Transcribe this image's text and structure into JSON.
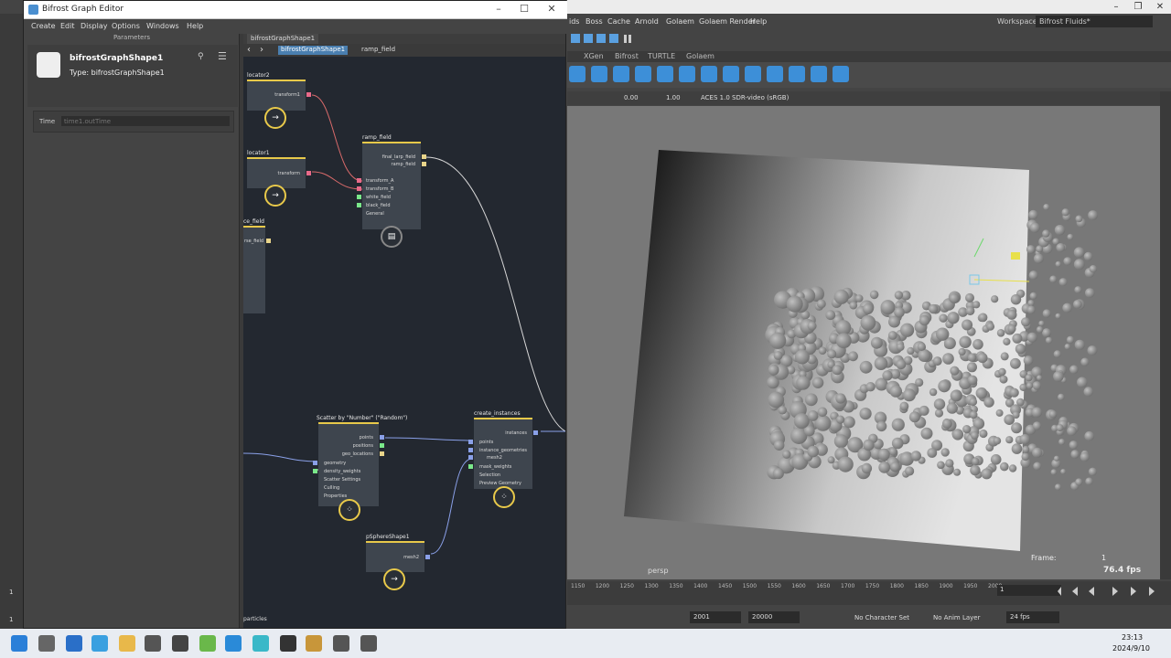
{
  "bifrost_editor": {
    "title": "Bifrost Graph Editor",
    "menu": [
      "Create",
      "Edit",
      "Display",
      "Options",
      "Windows",
      "Help"
    ],
    "parameters": {
      "header": "Parameters",
      "node_name": "bifrostGraphShape1",
      "node_type": "Type: bifrostGraphShape1",
      "time_label": "Time",
      "time_value": "time1.outTime"
    },
    "graph": {
      "tab": "bifrostGraphShape1",
      "breadcrumb": [
        "bifrostGraphShape1",
        "ramp_field"
      ],
      "nodes": {
        "locator2": {
          "title": "locator2",
          "port": "transform1"
        },
        "locator1": {
          "title": "locator1",
          "port": "transform"
        },
        "ramp_field": {
          "title": "ramp_field",
          "outputs": [
            "final_larp_field",
            "ramp_field"
          ],
          "inputs": [
            "transform_A",
            "transform_B",
            "white_field",
            "black_field",
            "General"
          ]
        },
        "partial_field": {
          "title": "ce_field",
          "port": "rse_field"
        },
        "scatter": {
          "title": "Scatter by \"Number\" (\"Random\")",
          "outputs": [
            "points",
            "positions",
            "geo_locations"
          ],
          "inputs": [
            "geometry",
            "density_weights",
            "Scatter Settings",
            "Culling",
            "Properties"
          ]
        },
        "create_instances": {
          "title": "create_instances",
          "output": "instances",
          "inputs": [
            "points",
            "instance_geometries",
            "mesh2",
            "mask_weights",
            "Selection",
            "Preview Geometry"
          ]
        },
        "psphere": {
          "title": "pSphereShape1",
          "port": "mesh2"
        }
      },
      "bottom_label": "particles"
    }
  },
  "maya": {
    "menu": [
      "ids",
      "Boss",
      "Cache",
      "Arnold",
      "Golaem",
      "Golaem Render",
      "Help"
    ],
    "workspace_label": "Workspace:",
    "workspace_value": "Bifrost Fluids*",
    "shelf_tabs": [
      "XGen",
      "Bifrost",
      "TURTLE",
      "Golaem"
    ],
    "viewport_toolbar": {
      "exposure": "0.00",
      "gamma": "1.00",
      "color_space": "ACES 1.0 SDR-video (sRGB)"
    },
    "viewport": {
      "camera": "persp",
      "frame_label": "Frame:",
      "frame_value": "1",
      "fps": "76.4 fps"
    },
    "timeline": {
      "ticks": [
        "1150",
        "1200",
        "1250",
        "1300",
        "1350",
        "1400",
        "1450",
        "1500",
        "1550",
        "1600",
        "1650",
        "1700",
        "1750",
        "1800",
        "1850",
        "1900",
        "1950",
        "2000"
      ],
      "current_frame": "1"
    },
    "range": {
      "start": "2001",
      "end": "20000",
      "character_set": "No Character Set",
      "anim_layer": "No Anim Layer",
      "fps": "24 fps"
    },
    "left_frame_values": [
      "1",
      "1"
    ]
  },
  "taskbar": {
    "time": "23:13",
    "date": "2024/9/10"
  }
}
